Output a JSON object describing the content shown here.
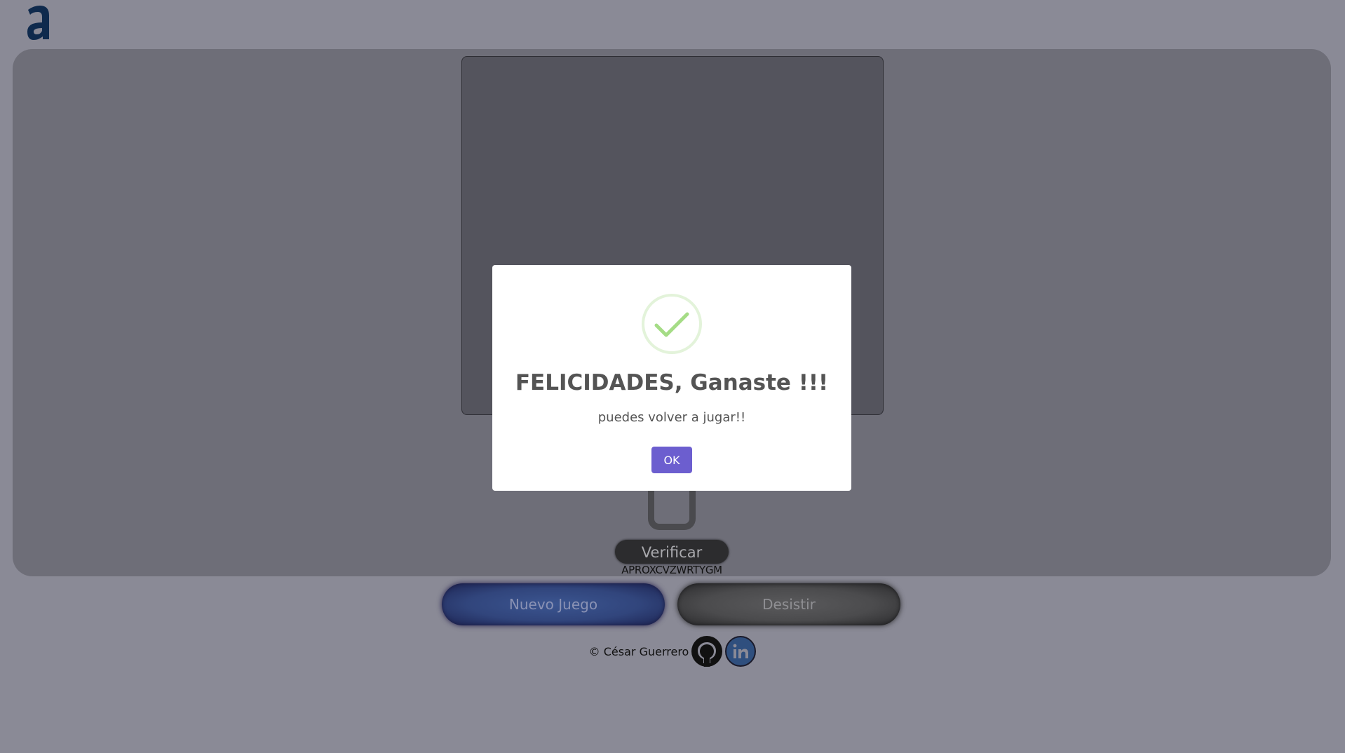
{
  "header": {
    "logo_icon": "letter-a-logo-icon",
    "logo_color": "#0f2a4d"
  },
  "game": {
    "verify_label": "Verificar",
    "letters_used": "APROXCVZWRTYGM"
  },
  "actions": {
    "new_game_label": "Nuevo Juego",
    "quit_label": "Desistir"
  },
  "footer": {
    "copyright": "© César Guerrero",
    "github_icon": "github-icon",
    "linkedin_icon": "linkedin-icon"
  },
  "dialog": {
    "icon": "success-check-icon",
    "title": "FELICIDADES, Ganaste !!!",
    "message": "puedes volver a jugar!!",
    "ok_label": "OK",
    "accent_color": "#6c5ecf",
    "success_color": "#a5dc86"
  }
}
